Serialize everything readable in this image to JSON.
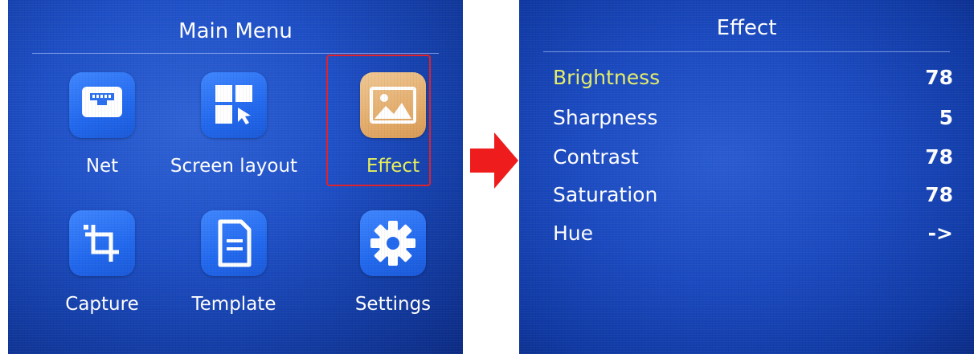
{
  "main_menu": {
    "title": "Main Menu",
    "items": [
      {
        "label": "Net",
        "icon": "ethernet-port-icon"
      },
      {
        "label": "Screen layout",
        "icon": "screen-layout-icon"
      },
      {
        "label": "Effect",
        "icon": "image-icon"
      },
      {
        "label": "Capture",
        "icon": "crop-icon"
      },
      {
        "label": "Template",
        "icon": "document-icon"
      },
      {
        "label": "Settings",
        "icon": "gear-icon"
      }
    ]
  },
  "effect_menu": {
    "title": "Effect",
    "rows": [
      {
        "name": "Brightness",
        "value": "78"
      },
      {
        "name": "Sharpness",
        "value": "5"
      },
      {
        "name": "Contrast",
        "value": "78"
      },
      {
        "name": "Saturation",
        "value": "78"
      },
      {
        "name": "Hue",
        "value": "->"
      }
    ]
  },
  "colors": {
    "highlight": "#e7f05b",
    "selection_border": "#e0202a",
    "arrow": "#ee1c1c"
  }
}
